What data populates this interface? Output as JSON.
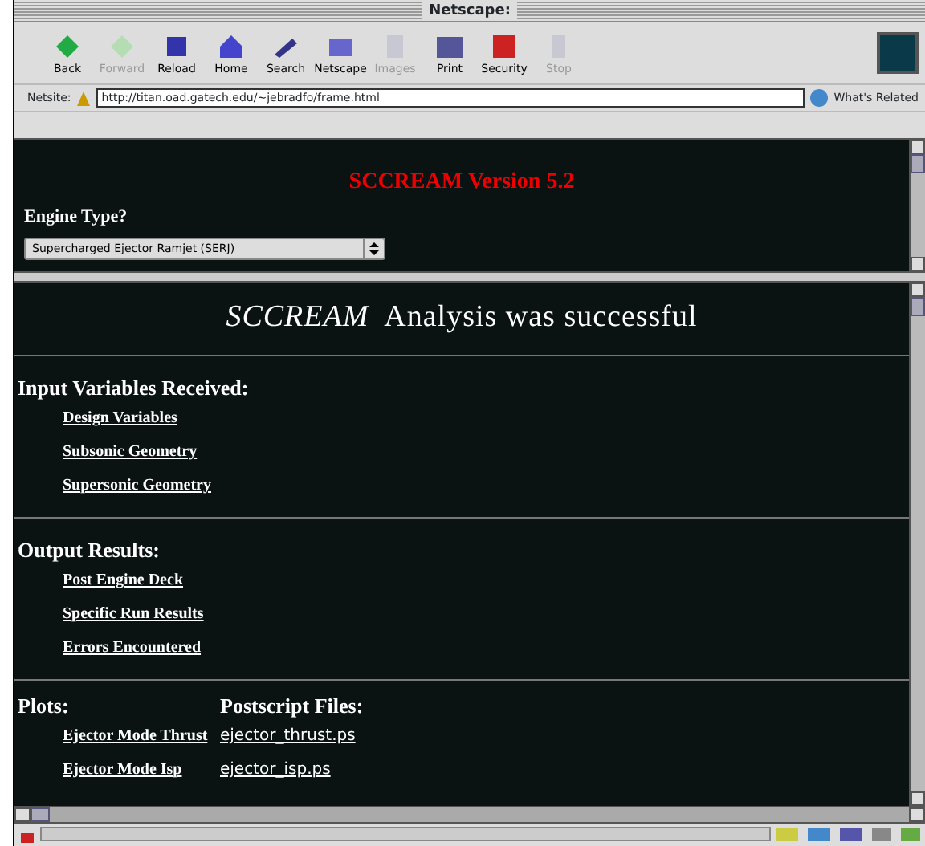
{
  "window": {
    "title": "Netscape:"
  },
  "toolbar": [
    {
      "label": "Back",
      "disabled": false
    },
    {
      "label": "Forward",
      "disabled": true
    },
    {
      "label": "Reload",
      "disabled": false
    },
    {
      "label": "Home",
      "disabled": false
    },
    {
      "label": "Search",
      "disabled": false
    },
    {
      "label": "Netscape",
      "disabled": false
    },
    {
      "label": "Images",
      "disabled": true
    },
    {
      "label": "Print",
      "disabled": false
    },
    {
      "label": "Security",
      "disabled": false
    },
    {
      "label": "Stop",
      "disabled": true
    }
  ],
  "location": {
    "label": "Netsite:",
    "url": "http://titan.oad.gatech.edu/~jebradfo/frame.html",
    "related": "What's Related"
  },
  "top_frame": {
    "title": "SCCREAM Version 5.2",
    "engine_label": "Engine Type?",
    "engine_value": "Supercharged Ejector Ramjet (SERJ)"
  },
  "bottom_frame": {
    "heading": "*SCCREAM*  Analysis was successful",
    "sections": [
      {
        "title": "Input Variables Received:",
        "links": [
          "Design Variables",
          "Subsonic Geometry",
          "Supersonic Geometry"
        ]
      },
      {
        "title": "Output Results:",
        "links": [
          "Post Engine Deck",
          "Specific Run Results",
          "Errors Encountered"
        ]
      }
    ],
    "plots": {
      "title": "Plots:",
      "files_title": "Postscript Files:",
      "rows": [
        {
          "plot": "Ejector Mode Thrust",
          "file": "ejector_thrust.ps"
        },
        {
          "plot": "Ejector Mode Isp",
          "file": "ejector_isp.ps"
        }
      ]
    }
  }
}
